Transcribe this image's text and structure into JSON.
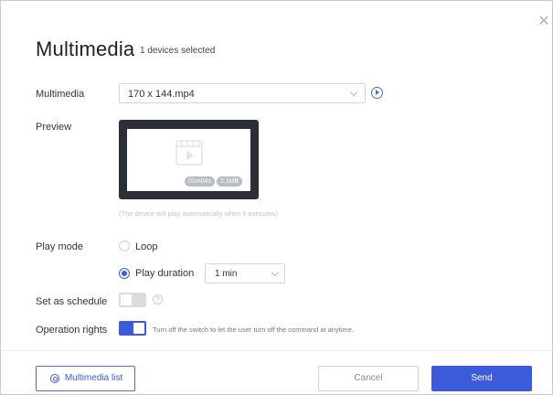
{
  "dialog": {
    "title": "Multimedia",
    "subtitle": "1 devices selected",
    "close_icon": "close-icon"
  },
  "form": {
    "multimedia_label": "Multimedia",
    "multimedia_value": "170 x 144.mp4",
    "preview_label": "Preview",
    "preview": {
      "duration_badge": "01m04s",
      "size_badge": "2.1MB",
      "icon": "video-file-icon"
    },
    "preview_hint": "(The device will play automatically when it executes)",
    "play_mode_label": "Play mode",
    "play_mode_options": [
      {
        "label": "Loop",
        "selected": false
      },
      {
        "label": "Play duration",
        "selected": true
      }
    ],
    "duration_value": "1 min",
    "schedule_label": "Set as schedule",
    "schedule_enabled": false,
    "rights_label": "Operation rights",
    "rights_enabled": true,
    "rights_note": "Turn off the switch to let the user turn off the command at anytime."
  },
  "footer": {
    "list_button": "Multimedia list",
    "cancel_button": "Cancel",
    "send_button": "Send"
  },
  "colors": {
    "accent": "#3b5bdb",
    "preview_frame": "#2c3036"
  }
}
